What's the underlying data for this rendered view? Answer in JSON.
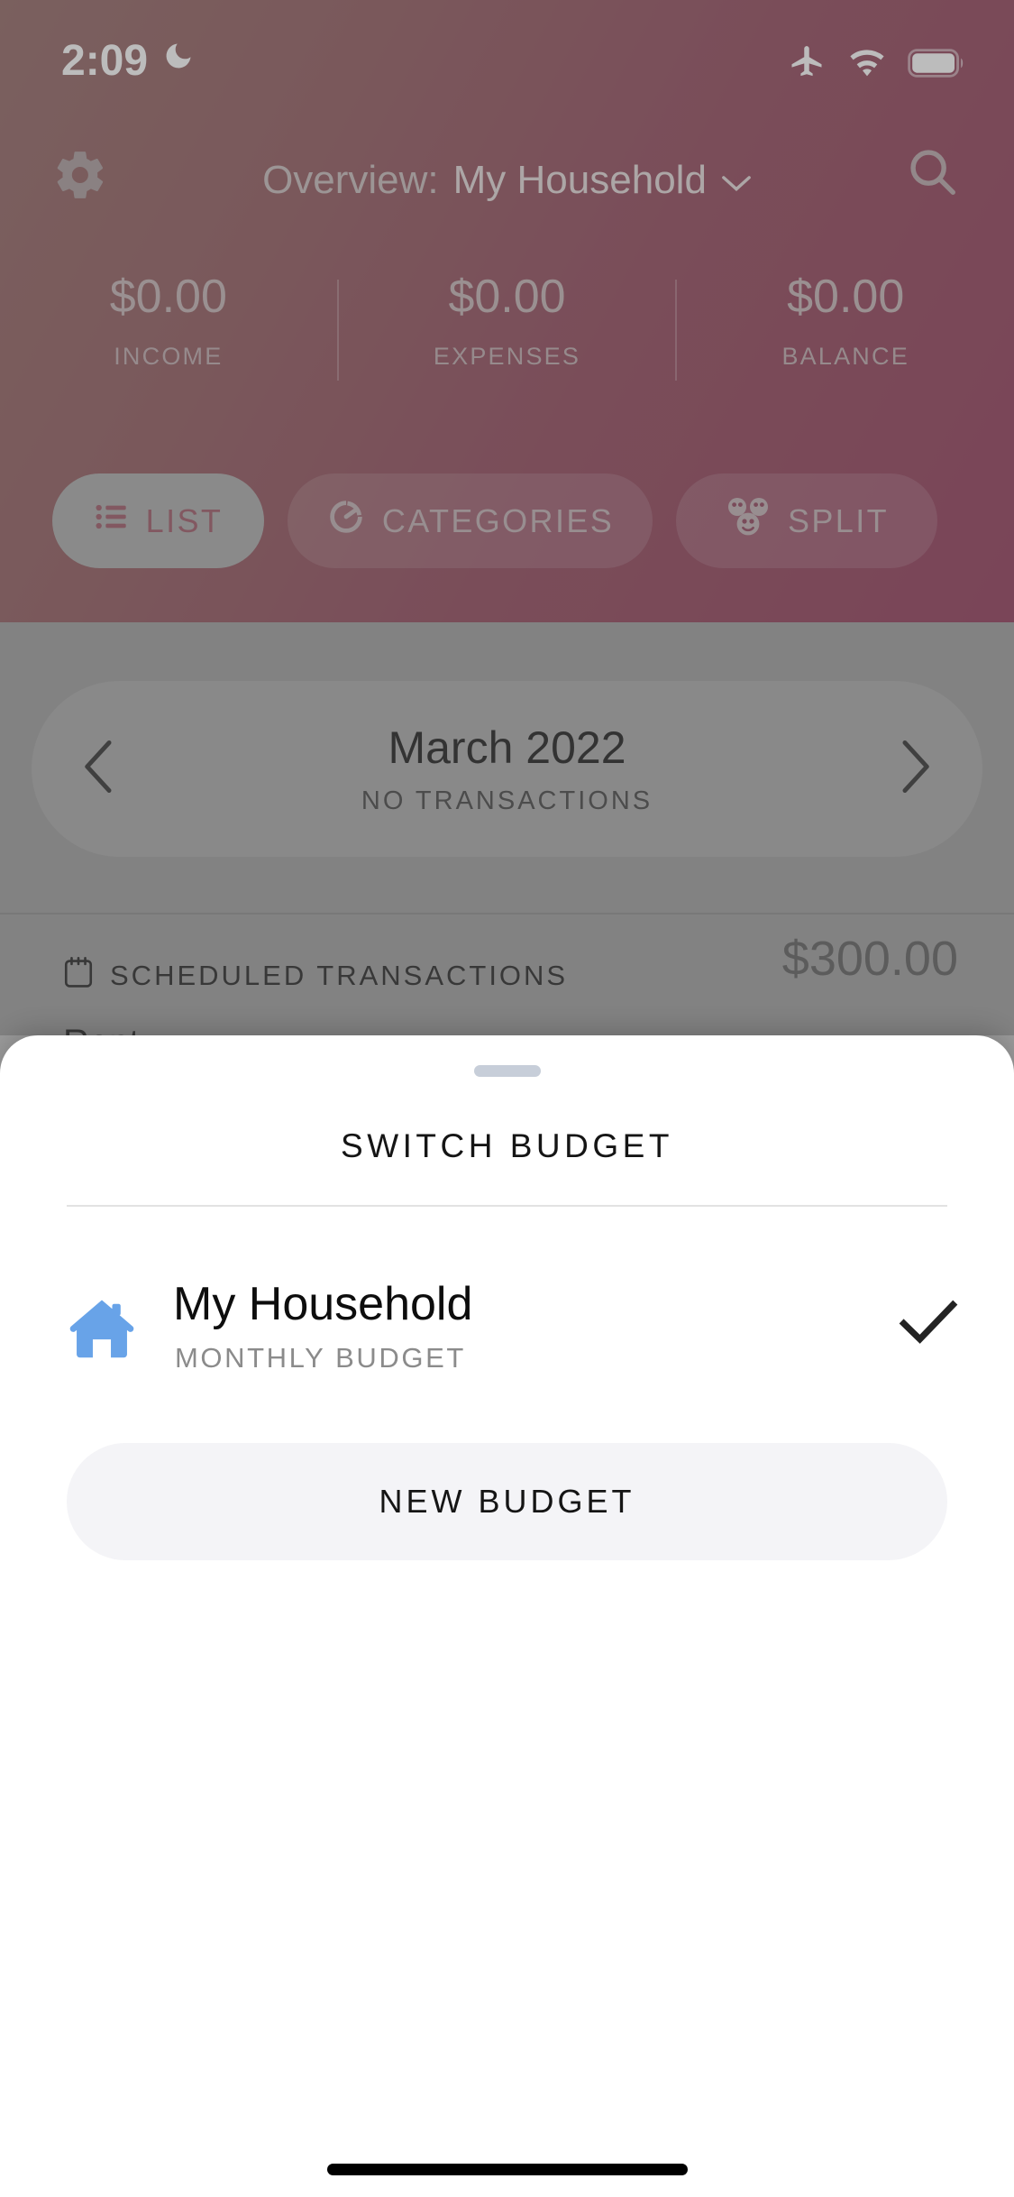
{
  "status_bar": {
    "time": "2:09",
    "icons": [
      "moon-icon",
      "airplane-mode-icon",
      "wifi-icon",
      "battery-icon"
    ]
  },
  "header": {
    "gear_icon": "gear-icon",
    "search_icon": "search-icon",
    "title_prefix": "Overview:",
    "title_budget": "My Household",
    "chevron": "⌄",
    "gradient_from": "#8e615e",
    "gradient_to": "#8d3253",
    "stats": [
      {
        "amount": "$0.00",
        "label": "INCOME"
      },
      {
        "amount": "$0.00",
        "label": "EXPENSES"
      },
      {
        "amount": "$0.00",
        "label": "BALANCE"
      }
    ],
    "tabs": [
      {
        "label": "LIST",
        "icon": "list-icon",
        "active": true
      },
      {
        "label": "CATEGORIES",
        "icon": "pie-chart-icon",
        "active": false
      },
      {
        "label": "SPLIT",
        "icon": "people-faces-icon",
        "active": false
      }
    ]
  },
  "main": {
    "month_nav": {
      "prev_icon": "chevron-left-icon",
      "next_icon": "chevron-right-icon",
      "month": "March 2022",
      "subtitle": "NO TRANSACTIONS"
    },
    "scheduled": {
      "icon": "calendar-icon",
      "label": "SCHEDULED TRANSACTIONS",
      "amount": "$300.00",
      "first_item": "Rent"
    }
  },
  "sheet": {
    "handle": "drag-handle",
    "title": "SWITCH BUDGET",
    "budgets": [
      {
        "icon": "house-icon",
        "icon_color": "#68a3e8",
        "name": "My Household",
        "type": "MONTHLY BUDGET",
        "selected": true,
        "check_icon": "check-icon"
      }
    ],
    "new_budget_label": "NEW BUDGET"
  },
  "home_indicator": "home-indicator"
}
